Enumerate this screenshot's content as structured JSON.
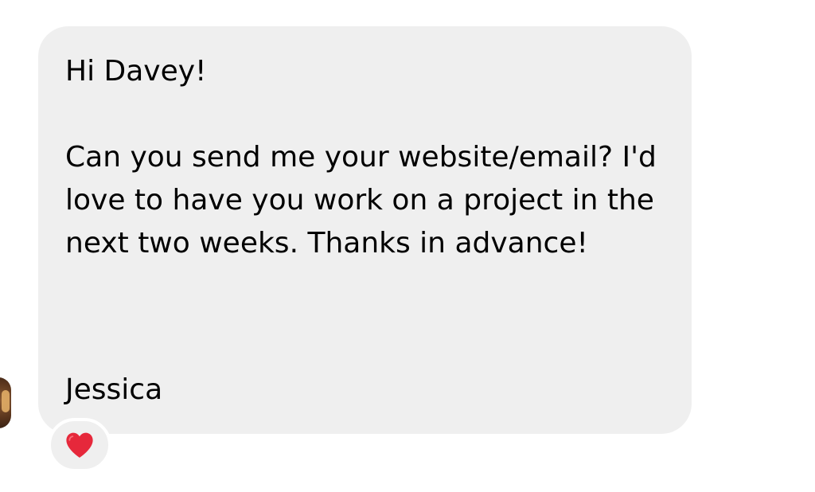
{
  "message": {
    "greeting": "Hi Davey!",
    "body": "Can you send me your website/email? I'd love to have you work on a project in the next two weeks. Thanks in advance!",
    "signature": "Jessica"
  },
  "reaction": {
    "icon": "heart-icon",
    "color": "#e6283b"
  },
  "avatar": {
    "icon": "profile-photo"
  },
  "colors": {
    "bubble_background": "#efefef",
    "text": "#000000",
    "page_background": "#ffffff"
  }
}
